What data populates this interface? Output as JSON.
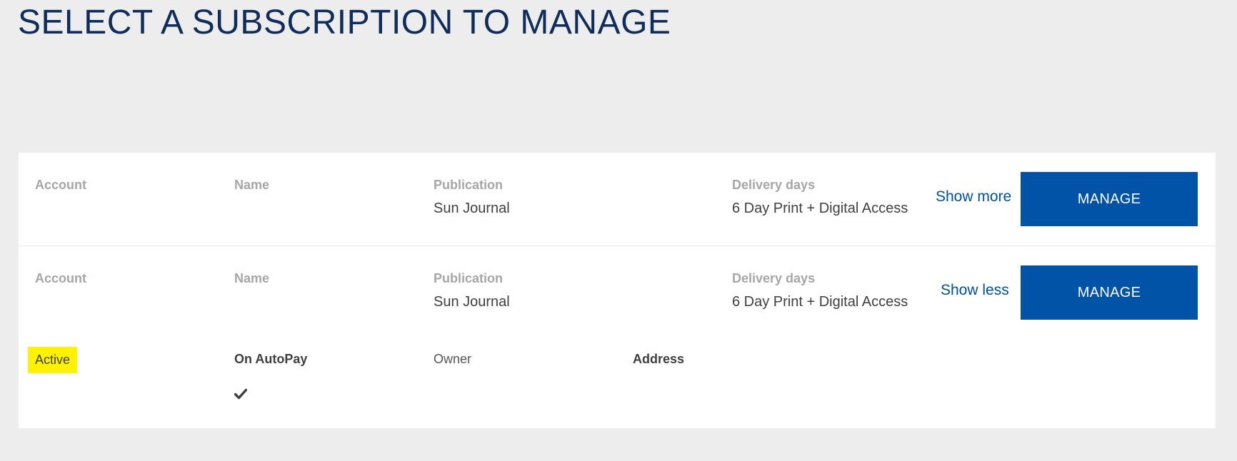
{
  "page": {
    "title": "SELECT A SUBSCRIPTION TO MANAGE"
  },
  "subscriptions": [
    {
      "labels": {
        "account": "Account",
        "name": "Name",
        "publication": "Publication",
        "delivery_days": "Delivery days"
      },
      "values": {
        "account": "",
        "name": "",
        "publication": "Sun Journal",
        "delivery_days": "6 Day Print + Digital Access"
      },
      "toggle_label": "Show more",
      "manage_label": "MANAGE",
      "expanded": false
    },
    {
      "labels": {
        "account": "Account",
        "name": "Name",
        "publication": "Publication",
        "delivery_days": "Delivery days"
      },
      "values": {
        "account": "",
        "name": "",
        "publication": "Sun Journal",
        "delivery_days": "6 Day Print + Digital Access"
      },
      "toggle_label": "Show less",
      "manage_label": "MANAGE",
      "expanded": true,
      "details": {
        "status": "Active",
        "autopay_label": "On AutoPay",
        "autopay_icon": "check-icon",
        "owner_label": "Owner",
        "address_label": "Address"
      }
    }
  ],
  "colors": {
    "background": "#ededed",
    "title": "#0f2d5c",
    "link": "#0050a0",
    "button": "#0053a6",
    "status_highlight": "#fff200"
  }
}
